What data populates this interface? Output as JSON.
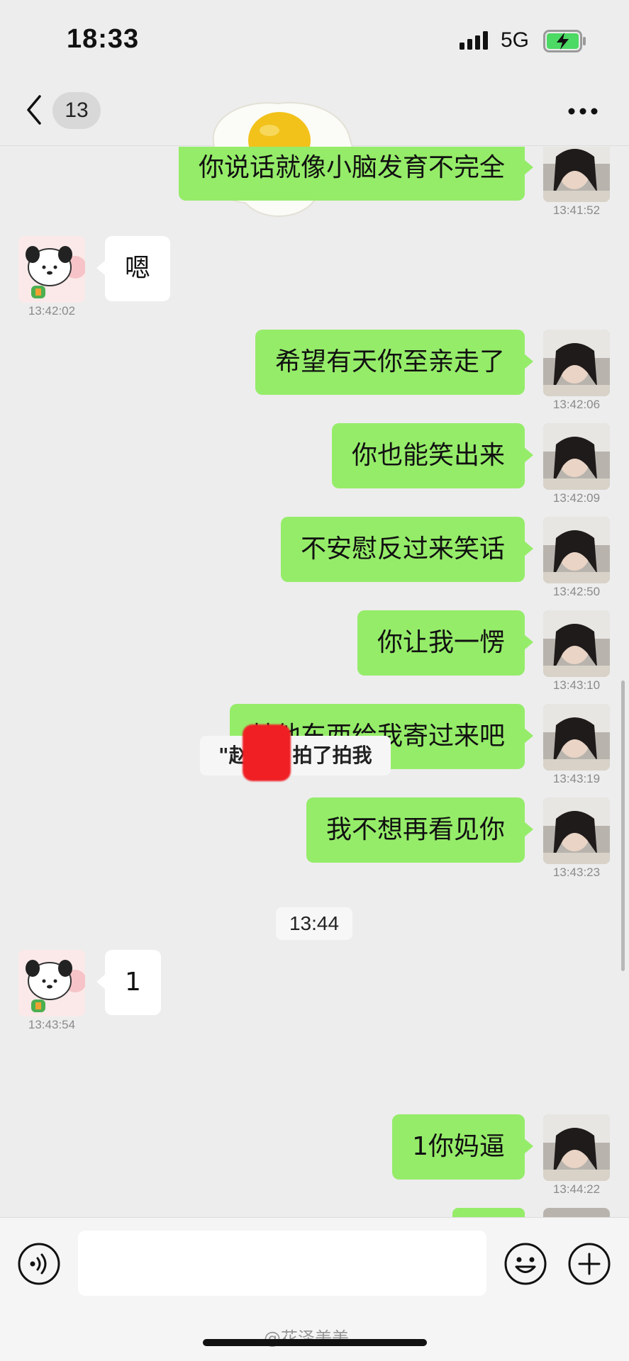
{
  "status_bar": {
    "time": "18:33",
    "network": "5G",
    "battery_state": "charging",
    "colors": {
      "battery": "#4cd964"
    }
  },
  "nav": {
    "unread_count": "13",
    "back_icon": "chevron-left-icon",
    "more_icon": "ellipsis-icon"
  },
  "messages": [
    {
      "side": "me",
      "text": "你说话就像小脑发育不完全",
      "time": "13:41:52"
    },
    {
      "side": "them",
      "text": "嗯",
      "time": "13:42:02"
    },
    {
      "side": "me",
      "text": "希望有天你至亲走了",
      "time": "13:42:06"
    },
    {
      "side": "me",
      "text": "你也能笑出来",
      "time": "13:42:09"
    },
    {
      "side": "me",
      "text": "不安慰反过来笑话",
      "time": "13:42:50"
    },
    {
      "side": "me",
      "text": "你让我一愣",
      "time": "13:43:10"
    },
    {
      "side": "me",
      "text": "其他东西给我寄过来吧",
      "time": "13:43:19"
    },
    {
      "side": "me",
      "text": "我不想再看见你",
      "time": "13:43:23"
    },
    {
      "side": "system",
      "text": "\"赵  瑞\" 拍了拍我"
    },
    {
      "side": "them",
      "text": "1",
      "time": "13:43:54"
    },
    {
      "side": "divider",
      "text": "13:44"
    },
    {
      "side": "me",
      "text": "1你妈逼",
      "time": "13:44:22"
    }
  ],
  "input_bar": {
    "placeholder": "",
    "voice_icon": "voice-icon",
    "emoji_icon": "emoji-icon",
    "plus_icon": "plus-icon"
  },
  "watermark": "@花泽美美",
  "colors": {
    "background": "#ededed",
    "outgoing_bubble": "#95ec69",
    "incoming_bubble": "#ffffff"
  }
}
